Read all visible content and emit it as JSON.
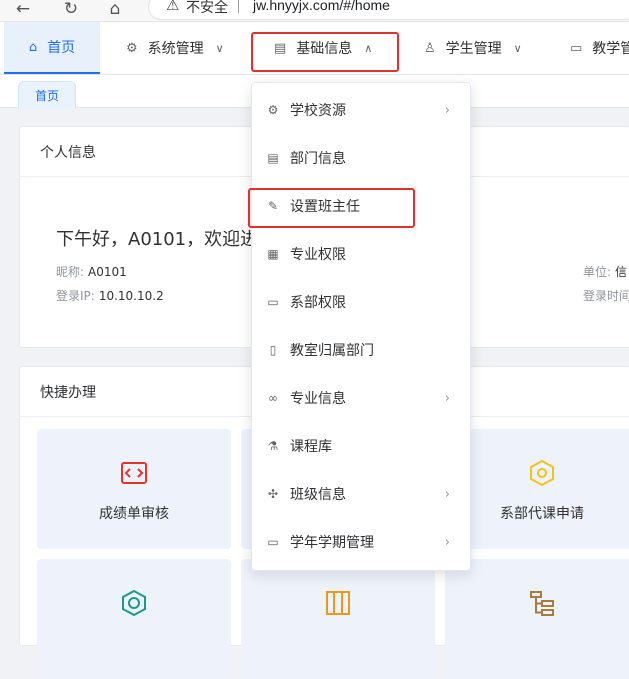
{
  "browser": {
    "back_icon": "←",
    "reload_icon": "↻",
    "home_icon": "⌂",
    "warning_icon": "⚠",
    "insecure_label": "不安全",
    "url": "jw.hnyyjx.com/#/home"
  },
  "topnav": {
    "items": [
      {
        "label": "首页",
        "icon": "home-icon"
      },
      {
        "label": "系统管理",
        "icon": "gear-icon"
      },
      {
        "label": "基础信息",
        "icon": "id-card-icon"
      },
      {
        "label": "学生管理",
        "icon": "user-icon"
      },
      {
        "label": "教学管理",
        "icon": "monitor-icon"
      }
    ]
  },
  "tabs": {
    "home": "首页"
  },
  "profile": {
    "title": "个人信息",
    "greeting": "下午好，A0101，欢迎进",
    "nickname_label": "昵称:",
    "nickname_value": "A0101",
    "ip_label": "登录IP:",
    "ip_value": "10.10.10.2",
    "unit_label": "单位:",
    "unit_value": "信",
    "login_time_label": "登录时间"
  },
  "quick": {
    "title": "快捷办理",
    "tiles": [
      {
        "label": "成绩单审核",
        "icon": "code-brackets-icon",
        "color": "#e0352b"
      },
      {
        "label": "",
        "icon": "",
        "color": ""
      },
      {
        "label": "系部代课申请",
        "icon": "hexagon-icon",
        "color": "#f0c419"
      },
      {
        "label": "",
        "icon": "hexagon-ring-icon",
        "color": "#1a9b8a"
      },
      {
        "label": "",
        "icon": "columns-icon",
        "color": "#e89a1a"
      },
      {
        "label": "",
        "icon": "tree-list-icon",
        "color": "#a57c3c"
      }
    ]
  },
  "dropdown": {
    "items": [
      {
        "label": "学校资源",
        "has_submenu": true,
        "icon": "school-resource-icon"
      },
      {
        "label": "部门信息",
        "has_submenu": false,
        "icon": "department-icon"
      },
      {
        "label": "设置班主任",
        "has_submenu": false,
        "icon": "edit-doc-icon"
      },
      {
        "label": "专业权限",
        "has_submenu": false,
        "icon": "major-permission-icon"
      },
      {
        "label": "系部权限",
        "has_submenu": false,
        "icon": "folder-icon"
      },
      {
        "label": "教室归属部门",
        "has_submenu": false,
        "icon": "classroom-icon"
      },
      {
        "label": "专业信息",
        "has_submenu": true,
        "icon": "link-icon"
      },
      {
        "label": "课程库",
        "has_submenu": false,
        "icon": "flask-icon"
      },
      {
        "label": "班级信息",
        "has_submenu": true,
        "icon": "puzzle-icon"
      },
      {
        "label": "学年学期管理",
        "has_submenu": true,
        "icon": "calendar-icon"
      }
    ]
  },
  "colors": {
    "accent": "#1f6feb",
    "highlight_box": "#e03030"
  }
}
